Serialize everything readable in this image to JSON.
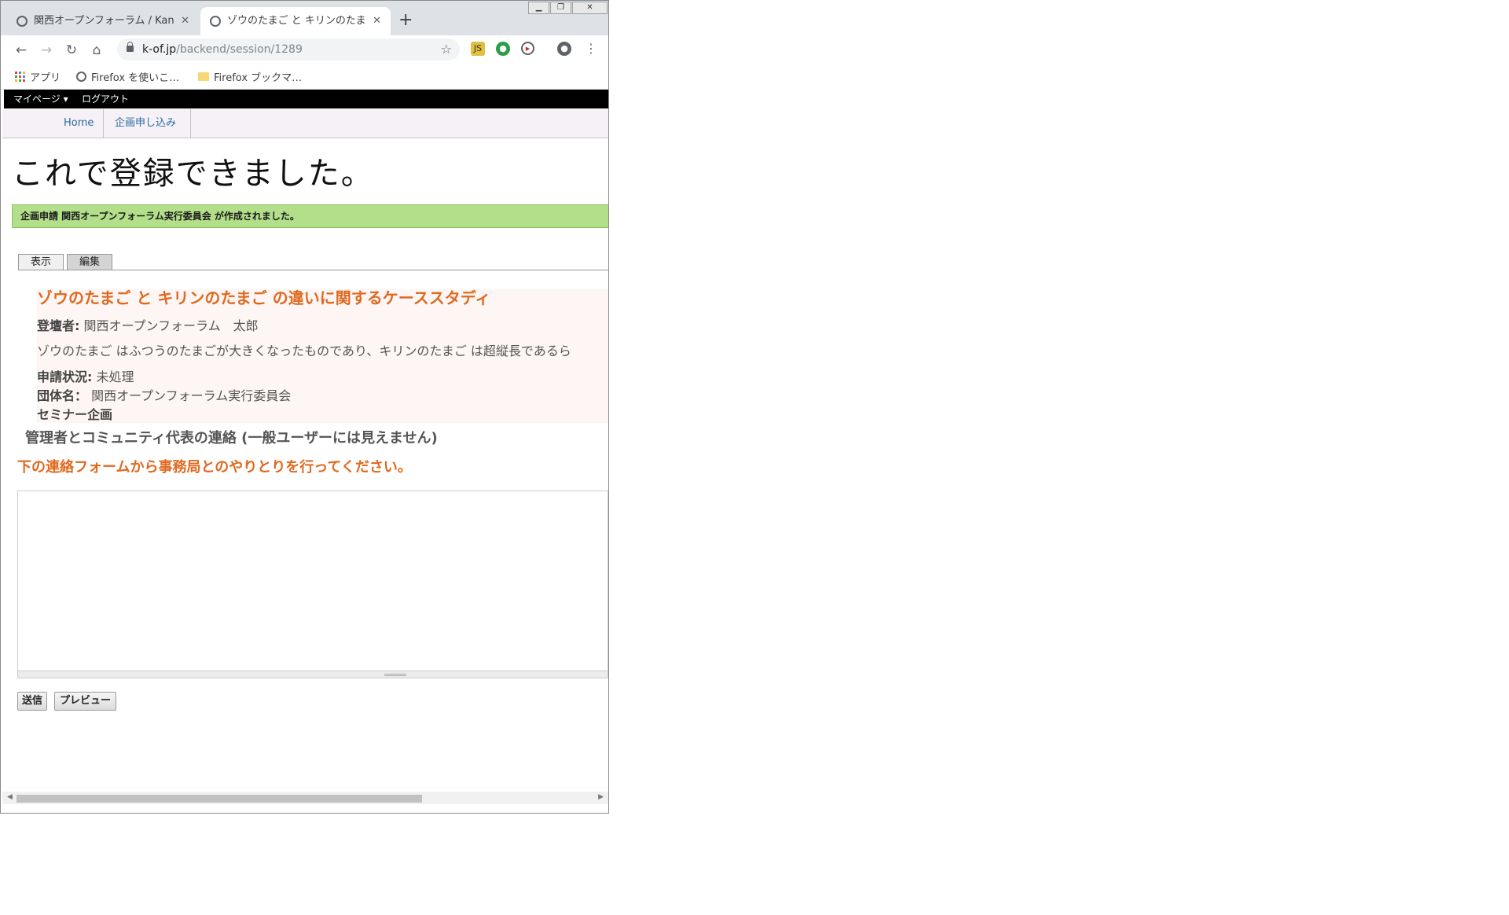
{
  "browser": {
    "tabs": [
      {
        "title": "関西オープンフォーラム / Kansai",
        "active": false
      },
      {
        "title": "ゾウのたまご と キリンのたまご の違いに関するケーススタディ",
        "active": true
      }
    ],
    "url_host": "k-of.jp",
    "url_path": "/backend/session/1289",
    "bookmarks": [
      {
        "label": "アプリ",
        "icon": "apps-icon"
      },
      {
        "label": "Firefox を使いこ…",
        "icon": "globe-icon"
      },
      {
        "label": "Firefox ブックマ…",
        "icon": "folder-icon"
      }
    ]
  },
  "admin_bar": {
    "mypage": "マイページ ▾",
    "logout": "ログアウト"
  },
  "site_nav": {
    "home": "Home",
    "apply": "企画申し込み"
  },
  "page": {
    "heading": "これで登録できました。",
    "status_message": "企画申請 関西オープンフォーラム実行委員会 が作成されました。",
    "tabs": {
      "view": "表示",
      "edit": "編集"
    },
    "node": {
      "title": "ゾウのたまご と キリンのたまご の違いに関するケーススタディ",
      "speaker_label": "登壇者:",
      "speaker_value": "関西オープンフォーラム　太郎",
      "description": "ゾウのたまご はふつうのたまごが大きくなったものであり、キリンのたまご は超縦長であるら",
      "status_label": "申請状況:",
      "status_value": "未処理",
      "group_label": "団体名：",
      "group_value": "関西オープンフォーラム実行委員会",
      "type": "セミナー企画"
    },
    "contact_heading": "管理者とコミュニティ代表の連絡 (一般ユーザーには見えません)",
    "contact_instruction": "下の連絡フォームから事務局とのやりとりを行ってください。",
    "message_value": "",
    "submit": "送信",
    "preview": "プレビュー"
  },
  "colors": {
    "accent_orange": "#e0691f",
    "status_green": "#b3df8a",
    "link_blue": "#2a6a9e"
  }
}
